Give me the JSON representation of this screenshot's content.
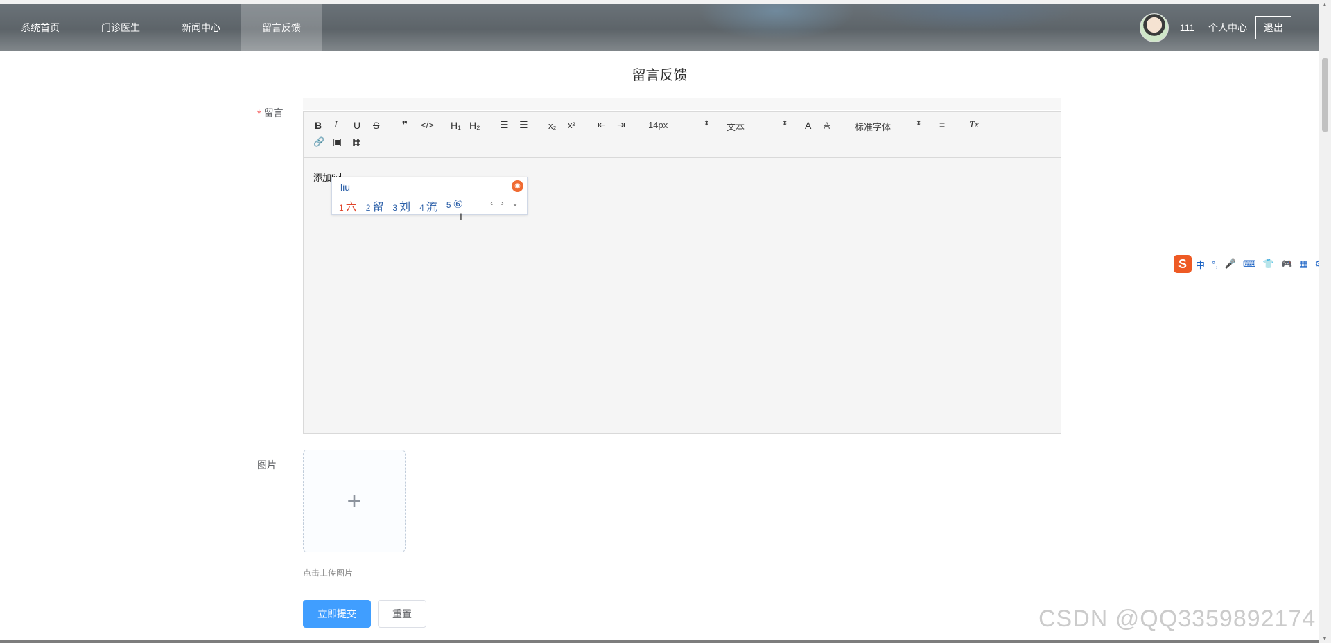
{
  "nav": {
    "items": [
      {
        "label": "系统首页"
      },
      {
        "label": "门诊医生"
      },
      {
        "label": "新闻中心"
      },
      {
        "label": "留言反馈"
      }
    ],
    "active_index": 3,
    "username": "111",
    "personal_center": "个人中心",
    "logout": "退出"
  },
  "page": {
    "title": "留言反馈"
  },
  "form": {
    "message_label": "留言",
    "required_mark": "*",
    "image_label": "图片",
    "upload_tip": "点击上传图片",
    "upload_icon": "+",
    "submit_label": "立即提交",
    "reset_label": "重置"
  },
  "editor": {
    "toolbar": {
      "bold": "B",
      "italic": "I",
      "underline": "U",
      "strike": "S",
      "quote": "❞",
      "code": "</>",
      "h1": "H₁",
      "h2": "H₂",
      "ordered_list": "☰",
      "bullet_list": "☰",
      "subscript": "x₂",
      "superscript": "x²",
      "outdent": "⇤",
      "indent": "⇥",
      "size": "14px",
      "header": "文本",
      "color": "A",
      "background": "A",
      "font": "标准字体",
      "align": "≡",
      "clean": "Tx",
      "link": "🔗",
      "image": "▣",
      "video": "▦"
    },
    "content": "添加liu"
  },
  "ime": {
    "input": "liu",
    "candidates": [
      {
        "n": "1",
        "text": "六"
      },
      {
        "n": "2",
        "text": "留"
      },
      {
        "n": "3",
        "text": "刘"
      },
      {
        "n": "4",
        "text": "流"
      },
      {
        "n": "5",
        "text": "⑥"
      }
    ],
    "nav": "‹ › ⌄"
  },
  "sogou_bar": {
    "logo": "S",
    "items": [
      "中",
      "°,",
      "🎤",
      "⌨",
      "👕",
      "🎮",
      "▦",
      "⚙"
    ]
  },
  "watermark": "CSDN @QQ3359892174",
  "colors": {
    "primary": "#409eff",
    "required": "#f56c6c",
    "ime_first": "#e0452b",
    "ime_text": "#2b5fa8",
    "sogou": "#ee5a24"
  }
}
